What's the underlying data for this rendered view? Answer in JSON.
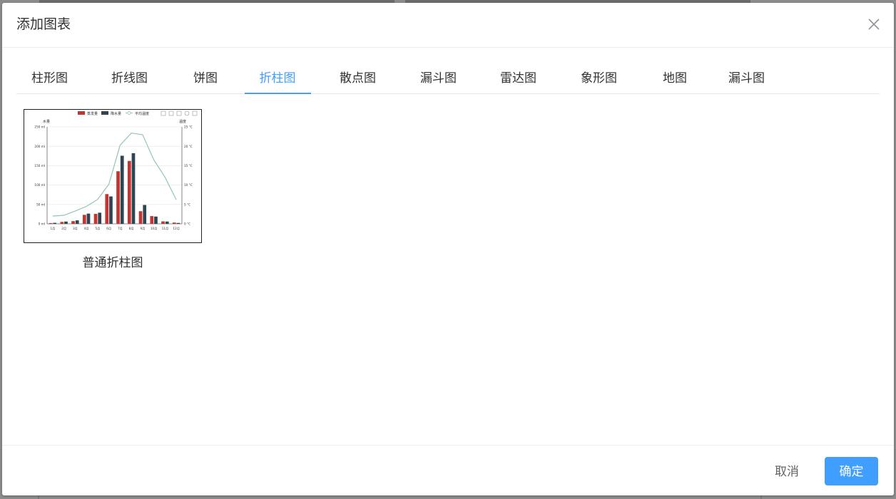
{
  "dialog": {
    "title": "添加图表"
  },
  "tabs": [
    {
      "label": "柱形图"
    },
    {
      "label": "折线图"
    },
    {
      "label": "饼图"
    },
    {
      "label": "折柱图",
      "active": true
    },
    {
      "label": "散点图"
    },
    {
      "label": "漏斗图"
    },
    {
      "label": "雷达图"
    },
    {
      "label": "象形图"
    },
    {
      "label": "地图"
    },
    {
      "label": "漏斗图"
    }
  ],
  "chart_item": {
    "name": "普通折柱图"
  },
  "footer": {
    "cancel_label": "取消",
    "ok_label": "确定"
  },
  "colors": {
    "accent": "#409eff",
    "evaporation": "#c23531",
    "precipitation": "#2f4554",
    "temperature": "#91c7ae"
  },
  "chart_data": {
    "type": "bar",
    "legend": [
      "蒸发量",
      "降水量",
      "平均温度"
    ],
    "legend_position": "top",
    "left_axis_name": "水量",
    "right_axis_name": "温度",
    "categories": [
      "1月",
      "2月",
      "3月",
      "4月",
      "5月",
      "6月",
      "7月",
      "8月",
      "9月",
      "10月",
      "11月",
      "12月"
    ],
    "left_ticks": [
      "0 ml",
      "50 ml",
      "100 ml",
      "150 ml",
      "200 ml",
      "250 ml"
    ],
    "right_ticks": [
      "0 °C",
      "5 °C",
      "10 °C",
      "15 °C",
      "20 °C",
      "25 °C"
    ],
    "ylim_left": [
      0,
      250
    ],
    "ylim_right": [
      0,
      25
    ],
    "series": [
      {
        "name": "蒸发量",
        "kind": "bar",
        "values": [
          2.0,
          4.9,
          7.0,
          23.2,
          25.6,
          76.7,
          135.6,
          162.2,
          32.6,
          20.0,
          6.4,
          3.3
        ]
      },
      {
        "name": "降水量",
        "kind": "bar",
        "values": [
          2.6,
          5.9,
          9.0,
          26.4,
          28.7,
          70.7,
          175.6,
          182.2,
          48.7,
          18.8,
          6.0,
          2.3
        ]
      },
      {
        "name": "平均温度",
        "kind": "line",
        "axis": "right",
        "values": [
          2.0,
          2.2,
          3.3,
          4.5,
          6.3,
          10.2,
          20.3,
          23.4,
          23.0,
          16.5,
          12.0,
          6.2
        ]
      }
    ]
  }
}
